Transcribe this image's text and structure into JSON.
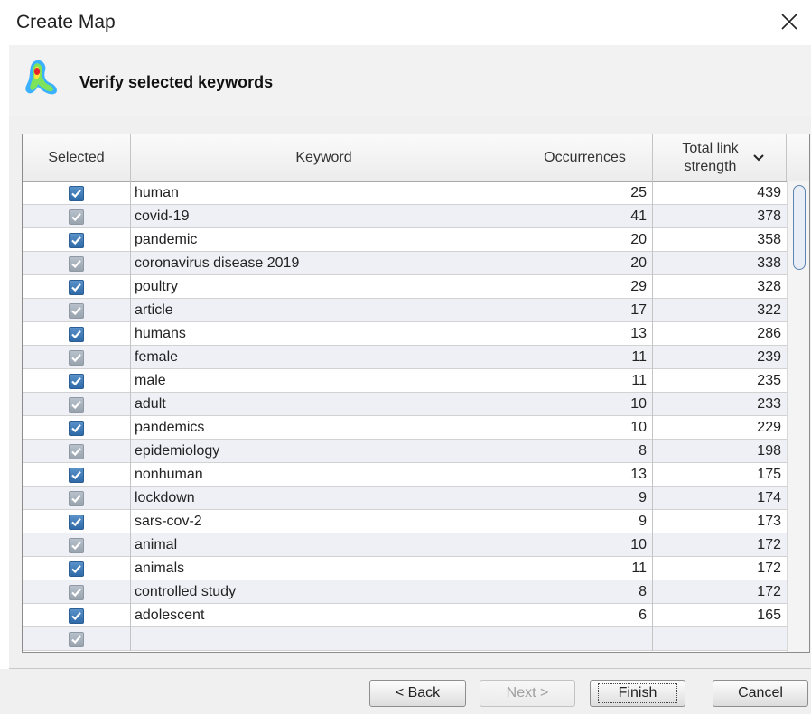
{
  "window": {
    "title": "Create Map",
    "close_icon": "close-x-icon"
  },
  "header": {
    "title": "Verify selected keywords",
    "icon": "vosviewer-map-icon"
  },
  "table": {
    "columns": [
      "Selected",
      "Keyword",
      "Occurrences",
      "Total link strength"
    ],
    "sort": {
      "column": "Total link strength",
      "direction": "descending",
      "icon": "chevron-down-icon"
    },
    "rows": [
      {
        "selected": true,
        "keyword": "human",
        "occurrences": "25",
        "strength": "439"
      },
      {
        "selected": true,
        "keyword": "covid-19",
        "occurrences": "41",
        "strength": "378"
      },
      {
        "selected": true,
        "keyword": "pandemic",
        "occurrences": "20",
        "strength": "358"
      },
      {
        "selected": true,
        "keyword": "coronavirus disease 2019",
        "occurrences": "20",
        "strength": "338"
      },
      {
        "selected": true,
        "keyword": "poultry",
        "occurrences": "29",
        "strength": "328"
      },
      {
        "selected": true,
        "keyword": "article",
        "occurrences": "17",
        "strength": "322"
      },
      {
        "selected": true,
        "keyword": "humans",
        "occurrences": "13",
        "strength": "286"
      },
      {
        "selected": true,
        "keyword": "female",
        "occurrences": "11",
        "strength": "239"
      },
      {
        "selected": true,
        "keyword": "male",
        "occurrences": "11",
        "strength": "235"
      },
      {
        "selected": true,
        "keyword": "adult",
        "occurrences": "10",
        "strength": "233"
      },
      {
        "selected": true,
        "keyword": "pandemics",
        "occurrences": "10",
        "strength": "229"
      },
      {
        "selected": true,
        "keyword": "epidemiology",
        "occurrences": "8",
        "strength": "198"
      },
      {
        "selected": true,
        "keyword": "nonhuman",
        "occurrences": "13",
        "strength": "175"
      },
      {
        "selected": true,
        "keyword": "lockdown",
        "occurrences": "9",
        "strength": "174"
      },
      {
        "selected": true,
        "keyword": "sars-cov-2",
        "occurrences": "9",
        "strength": "173"
      },
      {
        "selected": true,
        "keyword": "animal",
        "occurrences": "10",
        "strength": "172"
      },
      {
        "selected": true,
        "keyword": "animals",
        "occurrences": "11",
        "strength": "172"
      },
      {
        "selected": true,
        "keyword": "controlled study",
        "occurrences": "8",
        "strength": "172"
      },
      {
        "selected": true,
        "keyword": "adolescent",
        "occurrences": "6",
        "strength": "165"
      },
      {
        "selected": true,
        "keyword": "",
        "occurrences": "",
        "strength": ""
      }
    ]
  },
  "buttons": {
    "back": "< Back",
    "next": "Next >",
    "finish": "Finish",
    "cancel": "Cancel"
  },
  "colors": {
    "checkbox_active": "#2f6aa8",
    "checkbox_dim": "#98a3ae",
    "row_alt": "#eef0f5",
    "scroll_thumb": "#5d84b3"
  }
}
